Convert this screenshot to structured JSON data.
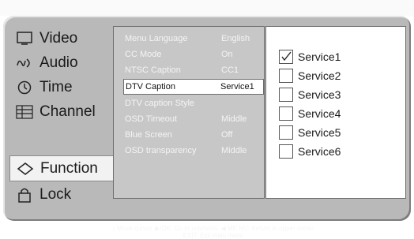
{
  "sidebar": {
    "items": [
      {
        "label": "Video",
        "icon": "tv-icon"
      },
      {
        "label": "Audio",
        "icon": "audio-icon"
      },
      {
        "label": "Time",
        "icon": "clock-icon"
      },
      {
        "label": "Channel",
        "icon": "channel-icon"
      },
      {
        "label": "Function",
        "icon": "function-icon",
        "selected": true
      },
      {
        "label": "Lock",
        "icon": "lock-icon"
      }
    ]
  },
  "menu": {
    "items": [
      {
        "label": "Menu Language",
        "value": "English"
      },
      {
        "label": "CC Mode",
        "value": "On"
      },
      {
        "label": "NTSC Caption",
        "value": "CC1"
      },
      {
        "label": "DTV Caption",
        "value": "Service1",
        "highlighted": true
      },
      {
        "label": "DTV caption Style",
        "value": ""
      },
      {
        "label": "OSD Timeout",
        "value": "Middle"
      },
      {
        "label": "Blue Screen",
        "value": "Off"
      },
      {
        "label": "OSD transparency",
        "value": "Middle"
      }
    ]
  },
  "services": {
    "items": [
      {
        "label": "Service1",
        "checked": true
      },
      {
        "label": "Service2",
        "checked": false
      },
      {
        "label": "Service3",
        "checked": false
      },
      {
        "label": "Service4",
        "checked": false
      },
      {
        "label": "Service5",
        "checked": false
      },
      {
        "label": "Service6",
        "checked": false
      }
    ]
  },
  "footer": {
    "line1": "↕ Move cursor.  ▶/OK: Go to submenu.  ◀ ME NU: Return to upper menu.",
    "line2": "EXIT: Exit main menu"
  }
}
